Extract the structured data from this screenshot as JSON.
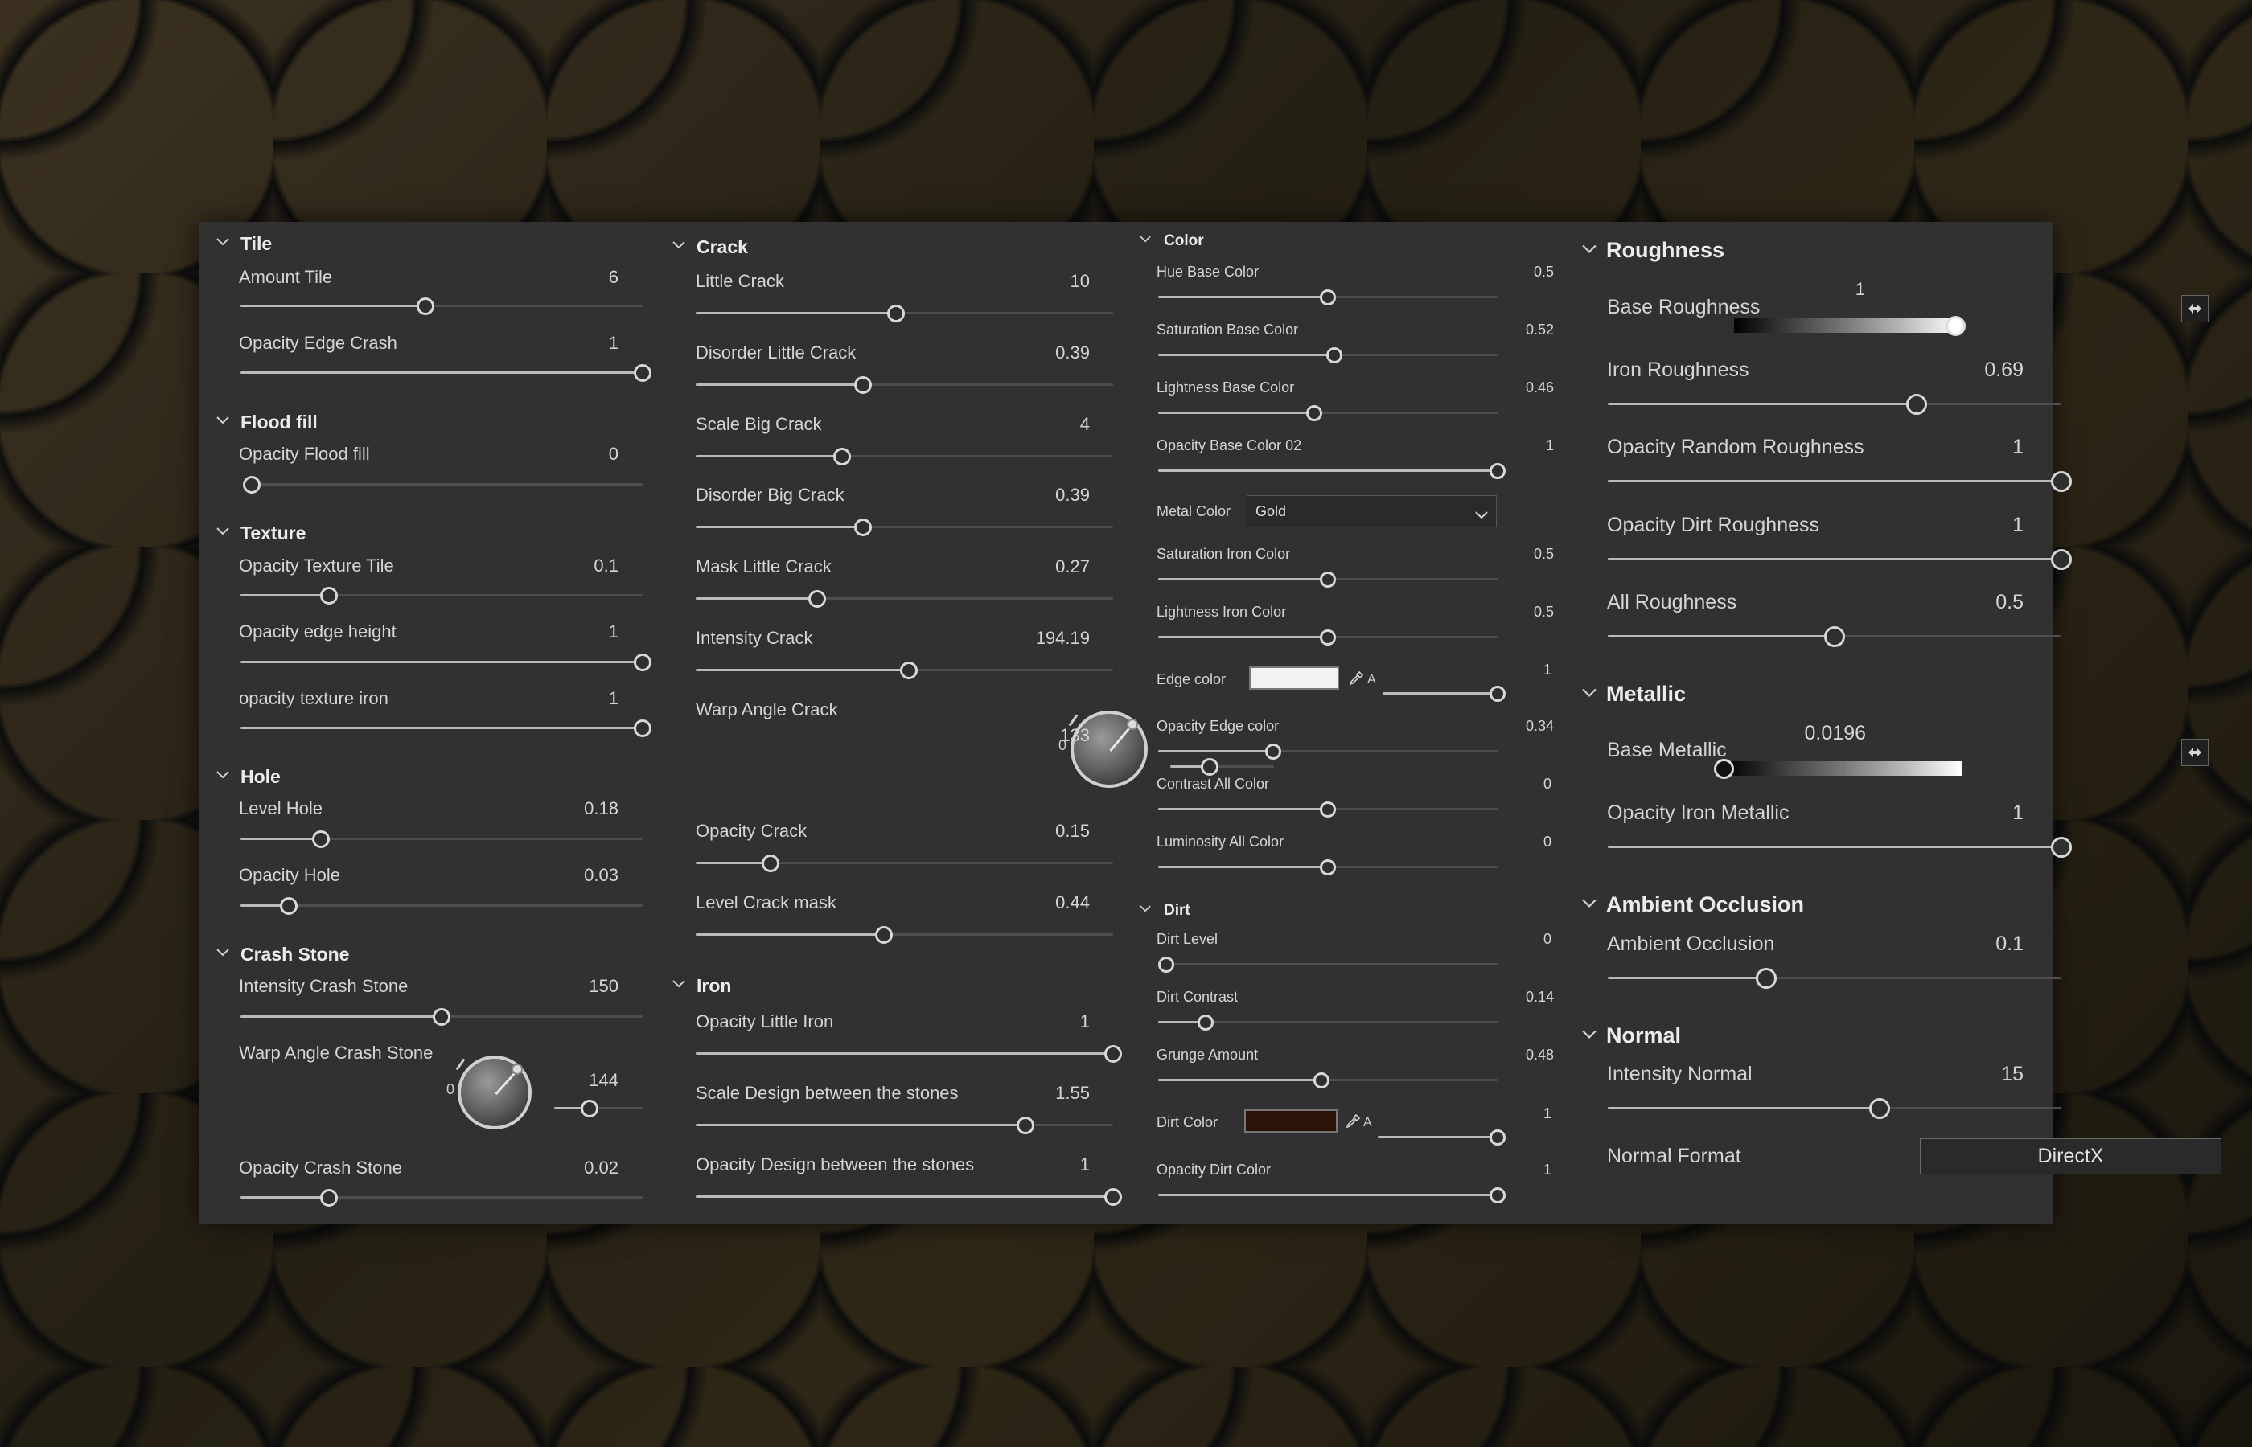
{
  "tile": {
    "title": "Tile",
    "amount_tile": {
      "label": "Amount Tile",
      "value": "6",
      "fraction": 0.46
    },
    "opacity_edge_crash": {
      "label": "Opacity Edge Crash",
      "value": "1",
      "fraction": 1.0
    }
  },
  "flood_fill": {
    "title": "Flood fill",
    "opacity_flood_fill": {
      "label": "Opacity Flood fill",
      "value": "0",
      "fraction": 0.0
    }
  },
  "texture": {
    "title": "Texture",
    "opacity_texture_tile": {
      "label": "Opacity Texture Tile",
      "value": "0.1",
      "fraction": 0.22
    },
    "opacity_edge_height": {
      "label": "Opacity edge height",
      "value": "1",
      "fraction": 1.0
    },
    "opacity_texture_iron": {
      "label": "opacity texture iron",
      "value": "1",
      "fraction": 1.0
    }
  },
  "hole": {
    "title": "Hole",
    "level_hole": {
      "label": "Level Hole",
      "value": "0.18",
      "fraction": 0.2
    },
    "opacity_hole": {
      "label": "Opacity Hole",
      "value": "0.03",
      "fraction": 0.12
    }
  },
  "crash_stone": {
    "title": "Crash Stone",
    "intensity_crash_stone": {
      "label": "Intensity Crash Stone",
      "value": "150",
      "fraction": 0.5
    },
    "warp_angle_crash_stone": {
      "label": "Warp Angle Crash Stone",
      "value": "144",
      "knob_zero": "0",
      "fraction": 0.4
    },
    "opacity_crash_stone": {
      "label": "Opacity Crash Stone",
      "value": "0.02",
      "fraction": 0.22
    }
  },
  "crack": {
    "title": "Crack",
    "little_crack": {
      "label": "Little Crack",
      "value": "10",
      "fraction": 0.48
    },
    "disorder_little_crack": {
      "label": "Disorder Little Crack",
      "value": "0.39",
      "fraction": 0.4
    },
    "scale_big_crack": {
      "label": "Scale Big Crack",
      "value": "4",
      "fraction": 0.35
    },
    "disorder_big_crack": {
      "label": "Disorder Big Crack",
      "value": "0.39",
      "fraction": 0.4
    },
    "mask_little_crack": {
      "label": "Mask Little Crack",
      "value": "0.27",
      "fraction": 0.29
    },
    "intensity_crack": {
      "label": "Intensity Crack",
      "value": "194.19",
      "fraction": 0.51
    },
    "warp_angle_crack": {
      "label": "Warp Angle Crack",
      "value": "133",
      "knob_zero": "0",
      "fraction": 0.38
    },
    "opacity_crack": {
      "label": "Opacity Crack",
      "value": "0.15",
      "fraction": 0.18
    },
    "level_crack_mask": {
      "label": "Level Crack mask",
      "value": "0.44",
      "fraction": 0.45
    }
  },
  "iron": {
    "title": "Iron",
    "opacity_little_iron": {
      "label": "Opacity Little Iron",
      "value": "1",
      "fraction": 1.0
    },
    "scale_design": {
      "label": "Scale Design between the stones",
      "value": "1.55",
      "fraction": 0.79
    },
    "opacity_design": {
      "label": "Opacity Design between the stones",
      "value": "1",
      "fraction": 1.0
    }
  },
  "color": {
    "title": "Color",
    "hue_base_color": {
      "label": "Hue Base Color",
      "value": "0.5",
      "fraction": 0.5
    },
    "saturation_base_color": {
      "label": "Saturation Base Color",
      "value": "0.52",
      "fraction": 0.52
    },
    "lightness_base_color": {
      "label": "Lightness Base Color",
      "value": "0.46",
      "fraction": 0.46
    },
    "opacity_base_color_02": {
      "label": "Opacity Base Color 02",
      "value": "1",
      "fraction": 1.0
    },
    "metal_color": {
      "label": "Metal Color",
      "value": "Gold"
    },
    "saturation_iron_color": {
      "label": "Saturation Iron Color",
      "value": "0.5",
      "fraction": 0.5
    },
    "lightness_iron_color": {
      "label": "Lightness Iron Color",
      "value": "0.5",
      "fraction": 0.5
    },
    "edge_color": {
      "label": "Edge color",
      "alpha_label": "A",
      "value": "1",
      "swatch": "#f2f2f2",
      "fraction": 1.0
    },
    "opacity_edge_color": {
      "label": "Opacity Edge color",
      "value": "0.34",
      "fraction": 0.34
    },
    "contrast_all_color": {
      "label": "Contrast All Color",
      "value": "0",
      "fraction": 0.5
    },
    "luminosity_all_color": {
      "label": "Luminosity All Color",
      "value": "0",
      "fraction": 0.5
    }
  },
  "dirt": {
    "title": "Dirt",
    "dirt_level": {
      "label": "Dirt Level",
      "value": "0",
      "fraction": 0.0
    },
    "dirt_contrast": {
      "label": "Dirt Contrast",
      "value": "0.14",
      "fraction": 0.14
    },
    "grunge_amount": {
      "label": "Grunge Amount",
      "value": "0.48",
      "fraction": 0.48
    },
    "dirt_color": {
      "label": "Dirt Color",
      "alpha_label": "A",
      "value": "1",
      "swatch": "#2a1208",
      "fraction": 1.0
    },
    "opacity_dirt_color": {
      "label": "Opacity Dirt Color",
      "value": "1",
      "fraction": 1.0
    }
  },
  "roughness": {
    "title": "Roughness",
    "base_roughness": {
      "label": "Base Roughness",
      "value": "1",
      "fraction": 1.0
    },
    "iron_roughness": {
      "label": "Iron Roughness",
      "value": "0.69",
      "fraction": 0.68
    },
    "opacity_random_roughness": {
      "label": "Opacity Random Roughness",
      "value": "1",
      "fraction": 1.0
    },
    "opacity_dirt_roughness": {
      "label": "Opacity Dirt Roughness",
      "value": "1",
      "fraction": 1.0
    },
    "all_roughness": {
      "label": "All Roughness",
      "value": "0.5",
      "fraction": 0.5
    }
  },
  "metallic": {
    "title": "Metallic",
    "base_metallic": {
      "label": "Base Metallic",
      "value": "0.0196",
      "fraction": 0.0196
    },
    "opacity_iron_metallic": {
      "label": "Opacity Iron Metallic",
      "value": "1",
      "fraction": 1.0
    }
  },
  "ambient_occlusion": {
    "title": "Ambient Occlusion",
    "ambient_occlusion": {
      "label": "Ambient Occlusion",
      "value": "0.1",
      "fraction": 0.35
    }
  },
  "normal": {
    "title": "Normal",
    "intensity_normal": {
      "label": "Intensity Normal",
      "value": "15",
      "fraction": 0.6
    },
    "normal_format": {
      "label": "Normal Format",
      "value": "DirectX"
    }
  }
}
